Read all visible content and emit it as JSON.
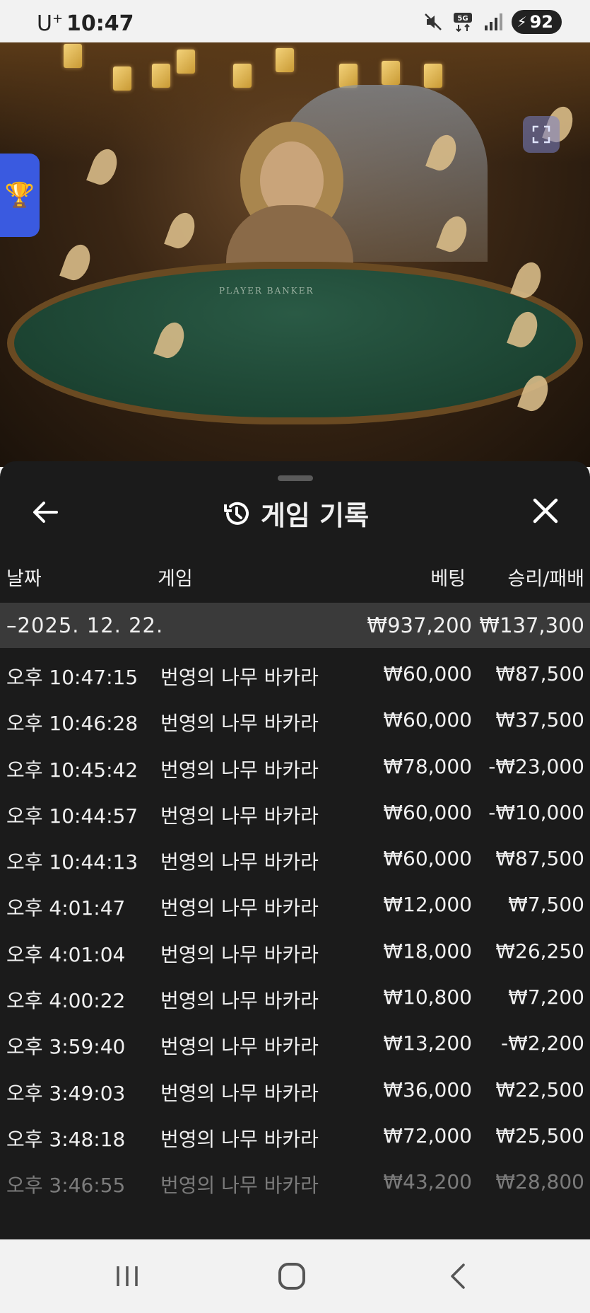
{
  "status_bar": {
    "carrier": "U",
    "carrier_sup": "+",
    "time": "10:47",
    "network_label": "5G",
    "battery": "92",
    "icons": [
      "mute-icon",
      "network-5g-icon",
      "signal-icon",
      "battery-charging-icon"
    ]
  },
  "video": {
    "table_label": "PLAYER        BANKER",
    "trophy_icon": "trophy-icon",
    "expand_icon": "fullscreen-icon"
  },
  "sheet": {
    "title": "게임 기록",
    "back_icon": "arrow-left-icon",
    "title_icon": "history-icon",
    "close_icon": "close-icon"
  },
  "columns": {
    "date": "날짜",
    "game": "게임",
    "bet": "베팅",
    "result": "승리/패배"
  },
  "summary": {
    "date": "–2025. 12. 22.",
    "bet": "₩937,200",
    "result": "₩137,300"
  },
  "rows": [
    {
      "time": "오후 10:47:15",
      "game": "번영의 나무 바카라",
      "bet": "₩60,000",
      "result": "₩87,500"
    },
    {
      "time": "오후 10:46:28",
      "game": "번영의 나무 바카라",
      "bet": "₩60,000",
      "result": "₩37,500"
    },
    {
      "time": "오후 10:45:42",
      "game": "번영의 나무 바카라",
      "bet": "₩78,000",
      "result": "-₩23,000"
    },
    {
      "time": "오후 10:44:57",
      "game": "번영의 나무 바카라",
      "bet": "₩60,000",
      "result": "-₩10,000"
    },
    {
      "time": "오후 10:44:13",
      "game": "번영의 나무 바카라",
      "bet": "₩60,000",
      "result": "₩87,500"
    },
    {
      "time": "오후 4:01:47",
      "game": "번영의 나무 바카라",
      "bet": "₩12,000",
      "result": "₩7,500"
    },
    {
      "time": "오후 4:01:04",
      "game": "번영의 나무 바카라",
      "bet": "₩18,000",
      "result": "₩26,250"
    },
    {
      "time": "오후 4:00:22",
      "game": "번영의 나무 바카라",
      "bet": "₩10,800",
      "result": "₩7,200"
    },
    {
      "time": "오후 3:59:40",
      "game": "번영의 나무 바카라",
      "bet": "₩13,200",
      "result": "-₩2,200"
    },
    {
      "time": "오후 3:49:03",
      "game": "번영의 나무 바카라",
      "bet": "₩36,000",
      "result": "₩22,500"
    },
    {
      "time": "오후 3:48:18",
      "game": "번영의 나무 바카라",
      "bet": "₩72,000",
      "result": "₩25,500"
    },
    {
      "time": "오후 3:46:55",
      "game": "번영의 나무 바카라",
      "bet": "₩43,200",
      "result": "₩28,800"
    }
  ],
  "nav_bar": {
    "icons": [
      "recent-apps-icon",
      "home-icon",
      "back-icon"
    ]
  },
  "colors": {
    "sheet_bg": "#1b1b1b",
    "summary_bg": "#3a3a3a",
    "text": "#f0f0f0",
    "trophy_button": "#3a5ae0"
  }
}
